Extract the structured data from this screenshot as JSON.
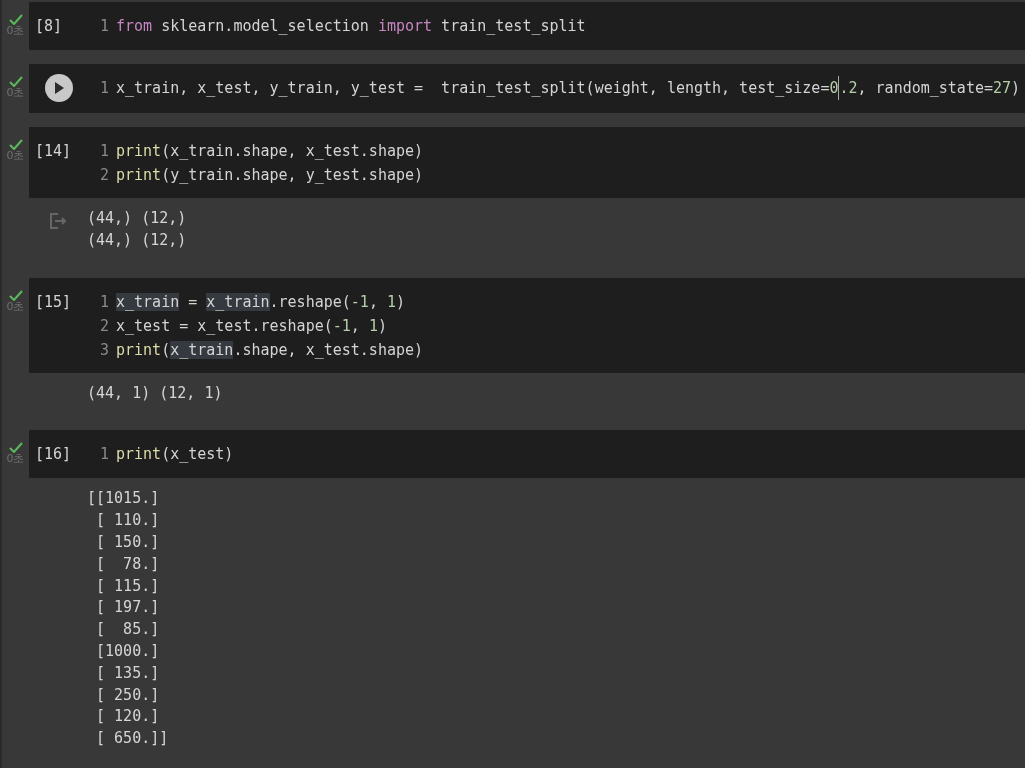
{
  "cells": [
    {
      "done": true,
      "time": "0초",
      "label": "[8]",
      "run_hover": false,
      "lines": [
        {
          "number": "1",
          "tokens": [
            {
              "kind": "keyword",
              "text": "from"
            },
            {
              "kind": "plain",
              "text": " sklearn.model_selection "
            },
            {
              "kind": "keyword",
              "text": "import"
            },
            {
              "kind": "plain",
              "text": " train_test_split"
            }
          ]
        }
      ]
    },
    {
      "done": true,
      "time": "0초",
      "run_hover": true,
      "lines": [
        {
          "number": "1",
          "tokens": [
            {
              "kind": "plain",
              "text": "x_train, x_test, y_train, y_test =  train_test_split(weight, length, test_size="
            },
            {
              "kind": "number",
              "text": "0"
            },
            {
              "kind": "cursor"
            },
            {
              "kind": "number",
              "text": ".2"
            },
            {
              "kind": "plain",
              "text": ", random_state="
            },
            {
              "kind": "number",
              "text": "27"
            },
            {
              "kind": "plain",
              "text": ")"
            }
          ]
        }
      ]
    },
    {
      "done": true,
      "time": "0초",
      "label": "[14]",
      "run_hover": false,
      "lines": [
        {
          "number": "1",
          "tokens": [
            {
              "kind": "builtin",
              "text": "print"
            },
            {
              "kind": "plain",
              "text": "(x_train.shape, x_test.shape)"
            }
          ]
        },
        {
          "number": "2",
          "tokens": [
            {
              "kind": "builtin",
              "text": "print"
            },
            {
              "kind": "plain",
              "text": "(y_train.shape, y_test.shape)"
            }
          ]
        }
      ],
      "output_icon": true,
      "output": [
        "(44,) (12,)",
        "(44,) (12,)"
      ]
    },
    {
      "done": true,
      "time": "0초",
      "label": "[15]",
      "run_hover": false,
      "lines": [
        {
          "number": "1",
          "tokens": [
            {
              "kind": "highlight",
              "text": "x_train"
            },
            {
              "kind": "plain",
              "text": " = "
            },
            {
              "kind": "highlight",
              "text": "x_train"
            },
            {
              "kind": "plain",
              "text": ".reshape("
            },
            {
              "kind": "number",
              "text": "-1"
            },
            {
              "kind": "plain",
              "text": ", "
            },
            {
              "kind": "number",
              "text": "1"
            },
            {
              "kind": "plain",
              "text": ")"
            }
          ]
        },
        {
          "number": "2",
          "tokens": [
            {
              "kind": "plain",
              "text": "x_test = x_test.reshape("
            },
            {
              "kind": "number",
              "text": "-1"
            },
            {
              "kind": "plain",
              "text": ", "
            },
            {
              "kind": "number",
              "text": "1"
            },
            {
              "kind": "plain",
              "text": ")"
            }
          ]
        },
        {
          "number": "3",
          "tokens": [
            {
              "kind": "builtin",
              "text": "print"
            },
            {
              "kind": "plain",
              "text": "("
            },
            {
              "kind": "highlight",
              "text": "x_train"
            },
            {
              "kind": "plain",
              "text": ".shape, x_test.shape)"
            }
          ]
        }
      ],
      "output_icon": false,
      "output": [
        "(44, 1) (12, 1)"
      ]
    },
    {
      "done": true,
      "time": "0초",
      "label": "[16]",
      "run_hover": false,
      "lines": [
        {
          "number": "1",
          "tokens": [
            {
              "kind": "builtin",
              "text": "print"
            },
            {
              "kind": "plain",
              "text": "(x_test)"
            }
          ]
        }
      ],
      "output_icon": false,
      "output": [
        "[[1015.]",
        " [ 110.]",
        " [ 150.]",
        " [  78.]",
        " [ 115.]",
        " [ 197.]",
        " [  85.]",
        " [1000.]",
        " [ 135.]",
        " [ 250.]",
        " [ 120.]",
        " [ 650.]]"
      ]
    }
  ]
}
